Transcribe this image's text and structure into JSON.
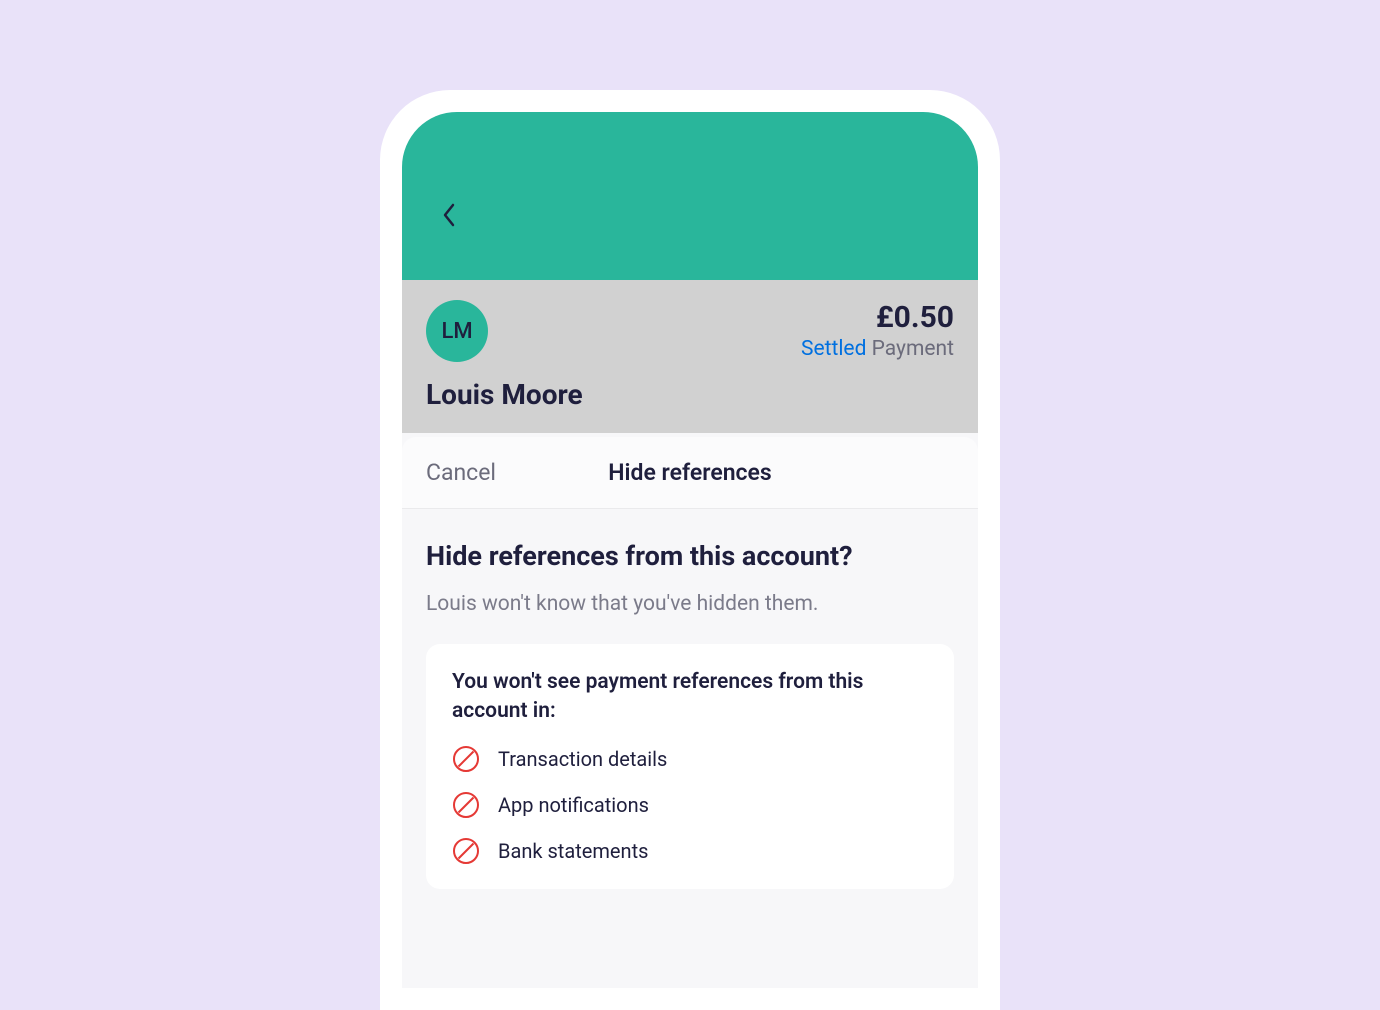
{
  "account": {
    "avatar_initials": "LM",
    "name": "Louis Moore",
    "amount": "£0.50",
    "status_settled": "Settled",
    "status_payment": "Payment"
  },
  "modal": {
    "cancel": "Cancel",
    "title": "Hide references",
    "heading": "Hide references from this account?",
    "subtext": "Louis won't know that you've hidden them.",
    "card": {
      "title": "You won't see payment references from this account in:",
      "items": [
        "Transaction details",
        "App notifications",
        "Bank statements"
      ]
    }
  }
}
